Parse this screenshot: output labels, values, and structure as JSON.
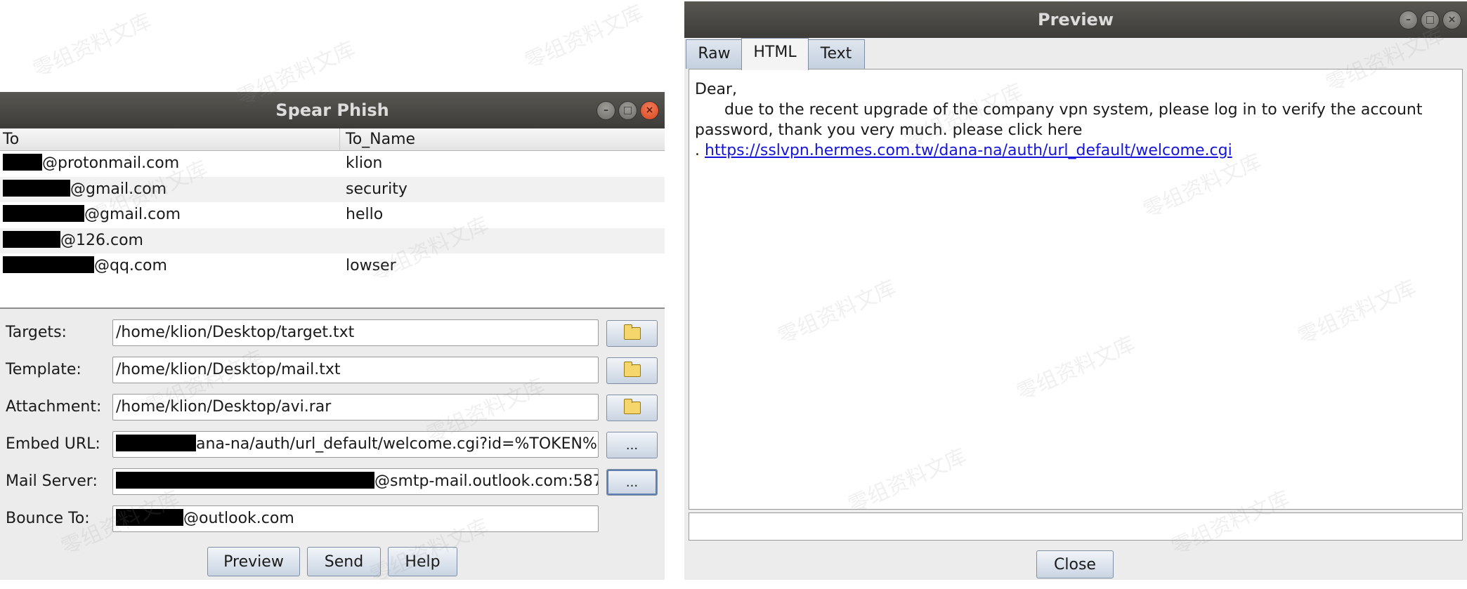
{
  "spear_phish": {
    "title": "Spear Phish",
    "columns": [
      "To",
      "To_Name"
    ],
    "rows": [
      {
        "to_suffix": "@protonmail.com",
        "name": "klion"
      },
      {
        "to_suffix": "@gmail.com",
        "name": "security"
      },
      {
        "to_suffix": "@gmail.com",
        "name": "hello"
      },
      {
        "to_suffix": "@126.com",
        "name": ""
      },
      {
        "to_suffix": "@qq.com",
        "name": "lowser"
      }
    ],
    "fields": {
      "targets": {
        "label": "Targets:",
        "value": "/home/klion/Desktop/target.txt"
      },
      "template": {
        "label": "Template:",
        "value": "/home/klion/Desktop/mail.txt"
      },
      "attachment": {
        "label": "Attachment:",
        "value": "/home/klion/Desktop/avi.rar"
      },
      "embed_url": {
        "label": "Embed URL:",
        "value": "ana-na/auth/url_default/welcome.cgi?id=%TOKEN%"
      },
      "mail_server": {
        "label": "Mail Server:",
        "value": "@smtp-mail.outlook.com:587"
      },
      "bounce_to": {
        "label": "Bounce To:",
        "value": "@outlook.com"
      }
    },
    "ellipsis_label": "...",
    "buttons": {
      "preview": "Preview",
      "send": "Send",
      "help": "Help"
    }
  },
  "preview": {
    "title": "Preview",
    "tabs": [
      "Raw",
      "HTML",
      "Text"
    ],
    "active_tab": "HTML",
    "body": {
      "greeting": "Dear,",
      "line1": "due to the recent upgrade of the company vpn system, please log in to verify the account",
      "line2": "password, thank you very much. please click here",
      "link_prefix": ". ",
      "link": "https://sslvpn.hermes.com.tw/dana-na/auth/url_default/welcome.cgi "
    },
    "close_label": "Close"
  },
  "window_controls": {
    "minimize": "–",
    "maximize": "□",
    "close": "×"
  },
  "watermark": "零组资料文库",
  "colors": {
    "titlebar": "#3d3c38",
    "close_button": "#e0542a",
    "link": "#1515d9"
  }
}
